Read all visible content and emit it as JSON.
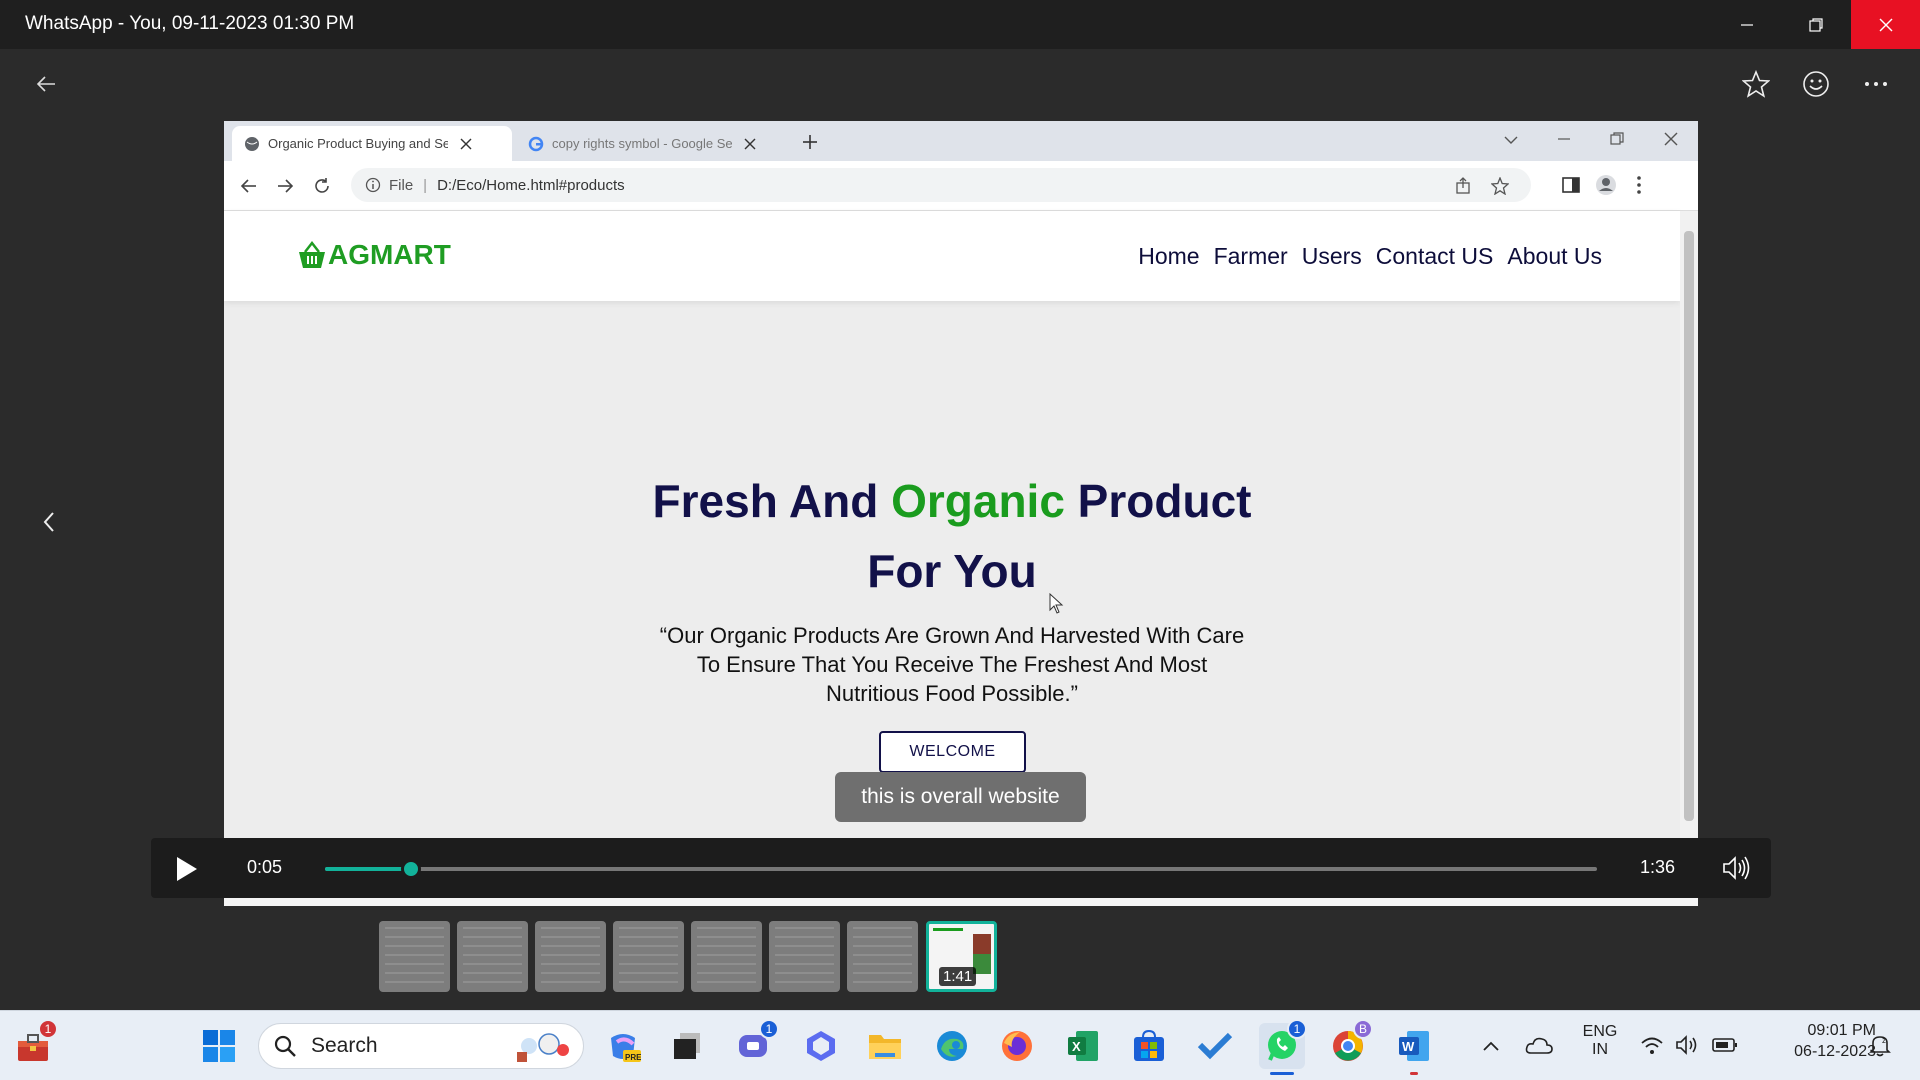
{
  "window": {
    "title": "WhatsApp - You, 09-11-2023 01:30 PM"
  },
  "browser": {
    "tabs": [
      {
        "label": "Organic Product Buying and Sel"
      },
      {
        "label": "copy rights symbol - Google Se"
      }
    ],
    "address": {
      "scheme": "File",
      "url": "D:/Eco/Home.html#products"
    }
  },
  "site": {
    "logo": "AGMART",
    "nav": [
      "Home",
      "Farmer",
      "Users",
      "Contact US",
      "About Us"
    ],
    "hero": {
      "title_part1": "Fresh And ",
      "title_highlight": "Organic",
      "title_part2": " Product",
      "title_line2": "For You",
      "quote_line1": "“Our Organic Products Are Grown And Harvested With Care",
      "quote_line2": "To Ensure That You Receive The Freshest And Most",
      "quote_line3": "Nutritious Food Possible.”",
      "button": "WELCOME"
    }
  },
  "caption": "this is overall website",
  "player": {
    "current_time": "0:05",
    "total_time": "1:36",
    "progress": 0.068
  },
  "thumbnails": {
    "selected_duration": "1:41"
  },
  "taskbar": {
    "search_placeholder": "Search",
    "language": "ENG",
    "region": "IN",
    "time": "09:01 PM",
    "date": "06-12-2023",
    "badges": {
      "widgets": "1",
      "teams": "1",
      "whatsapp": "1",
      "chrome": "B"
    }
  },
  "colors": {
    "accent": "#12b29a",
    "brand_green": "#1a9c1e",
    "brand_navy": "#121149",
    "close_red": "#e81123"
  }
}
